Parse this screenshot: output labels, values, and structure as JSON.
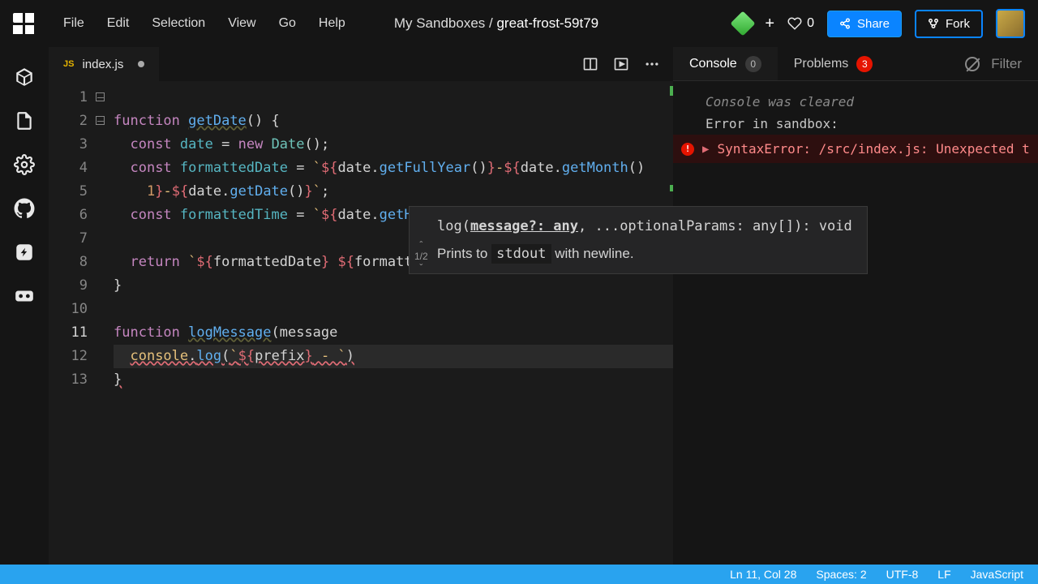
{
  "menus": [
    "File",
    "Edit",
    "Selection",
    "View",
    "Go",
    "Help"
  ],
  "breadcrumb": {
    "root": "My Sandboxes",
    "sep": " / ",
    "project": "great-frost-59t79"
  },
  "likes": "0",
  "buttons": {
    "share": "Share",
    "fork": "Fork"
  },
  "tab": {
    "icon": "JS",
    "name": "index.js"
  },
  "code": {
    "lines": [
      "function getDate() {",
      "  const date = new Date();",
      "  const formattedDate = `${date.getFullYear()}-${date.getMonth()",
      "    1}-${date.getDate()}`;",
      "  const formattedTime = `${date.getHours()}:${date.getMinutes()}",
      "",
      "  return `${formattedDate} ${formattedTime}`;",
      "}",
      "",
      "function logMessage(message",
      "  console.log(`${prefix} - `)",
      "}",
      ""
    ]
  },
  "hint": {
    "sig_pre": "log(",
    "sig_u": "message?: any",
    "sig_post": ", ...optionalParams: any[]): void",
    "nav_up": "ˆ",
    "nav_count": "1/2",
    "nav_down": "ˇ",
    "desc_pre": "Prints to ",
    "desc_code": "stdout",
    "desc_post": " with newline."
  },
  "console": {
    "tab1": "Console",
    "tab1_badge": "0",
    "tab2": "Problems",
    "tab2_badge": "3",
    "filter": "Filter",
    "line1": "Console was cleared",
    "line2": "Error in sandbox:",
    "error": "SyntaxError: /src/index.js: Unexpected t"
  },
  "status": {
    "pos": "Ln 11, Col 28",
    "spaces": "Spaces: 2",
    "enc": "UTF-8",
    "eol": "LF",
    "lang": "JavaScript"
  }
}
